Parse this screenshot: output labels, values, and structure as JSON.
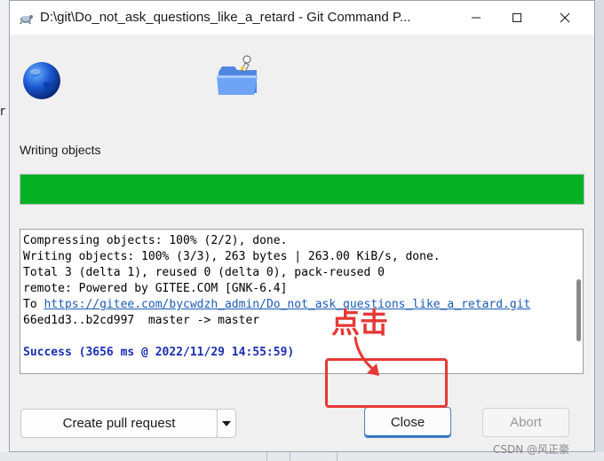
{
  "background": {
    "edge_char": "r"
  },
  "window": {
    "title": "D:\\git\\Do_not_ask_questions_like_a_retard - Git Command P...",
    "controls": {
      "minimize": "minimize-icon",
      "maximize": "maximize-icon",
      "close": "close-icon"
    }
  },
  "status": {
    "label": "Writing objects",
    "progress_percent": 100
  },
  "log": {
    "lines": [
      "Compressing objects: 100% (2/2), done.",
      "Writing objects: 100% (3/3), 263 bytes | 263.00 KiB/s, done.",
      "Total 3 (delta 1), reused 0 (delta 0), pack-reused 0",
      "remote: Powered by GITEE.COM [GNK-6.4]",
      "66ed1d3..b2cd997  master -> master"
    ],
    "to_prefix": "To ",
    "to_url": "https://gitee.com/bycwdzh_admin/Do_not_ask_questions_like_a_retard.git",
    "success": "Success (3656 ms @ 2022/11/29 14:55:59)"
  },
  "buttons": {
    "create_pull_request": "Create pull request",
    "close": "Close",
    "abort": "Abort"
  },
  "annotation": {
    "text": "点击"
  },
  "watermark": "CSDN @风正豪",
  "colors": {
    "progress": "#06b025",
    "annotation": "#e53935",
    "link": "#1a5bb5",
    "success": "#1a2fb0"
  }
}
